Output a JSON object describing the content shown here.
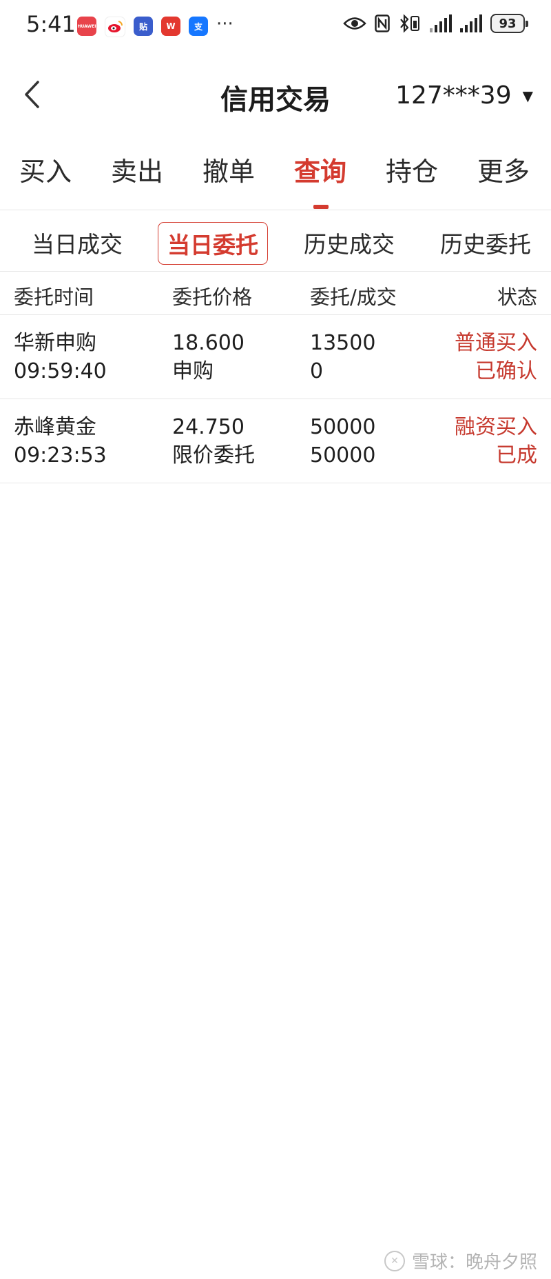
{
  "status_bar": {
    "time": "5:41",
    "notification_icons": [
      {
        "name": "huawei-appgallery-icon",
        "label": "HUAWEI",
        "color": "#e8434b"
      },
      {
        "name": "weibo-icon",
        "label": "微",
        "color": "#f0a238"
      },
      {
        "name": "tieba-icon",
        "label": "贴",
        "color": "#3a5dcc"
      },
      {
        "name": "wps-icon",
        "label": "W",
        "color": "#e3382f"
      },
      {
        "name": "alipay-icon",
        "label": "支",
        "color": "#1677ff"
      }
    ],
    "more": "···",
    "battery_level": "93"
  },
  "header": {
    "title": "信用交易",
    "account": "127***39",
    "caret": "▼"
  },
  "main_tabs": [
    {
      "label": "买入",
      "active": false
    },
    {
      "label": "卖出",
      "active": false
    },
    {
      "label": "撤单",
      "active": false
    },
    {
      "label": "查询",
      "active": true
    },
    {
      "label": "持仓",
      "active": false
    },
    {
      "label": "更多",
      "active": false
    }
  ],
  "sub_tabs": [
    {
      "label": "当日成交",
      "active": false
    },
    {
      "label": "当日委托",
      "active": true
    },
    {
      "label": "历史成交",
      "active": false
    },
    {
      "label": "历史委托",
      "active": false
    }
  ],
  "table": {
    "columns": [
      "委托时间",
      "委托价格",
      "委托/成交",
      "状态"
    ],
    "rows": [
      {
        "name": "华新申购",
        "time": "09:59:40",
        "price": "18.600",
        "order_type": "申购",
        "order_qty": "13500",
        "filled_qty": "0",
        "direction": "普通买入",
        "status": "已确认"
      },
      {
        "name": "赤峰黄金",
        "time": "09:23:53",
        "price": "24.750",
        "order_type": "限价委托",
        "order_qty": "50000",
        "filled_qty": "50000",
        "direction": "融资买入",
        "status": "已成"
      }
    ]
  },
  "watermark": {
    "text": "雪球：晚舟夕照"
  },
  "colors": {
    "accent": "#d43b2f",
    "status_text": "#c6392e",
    "divider": "#e6e6e6"
  }
}
